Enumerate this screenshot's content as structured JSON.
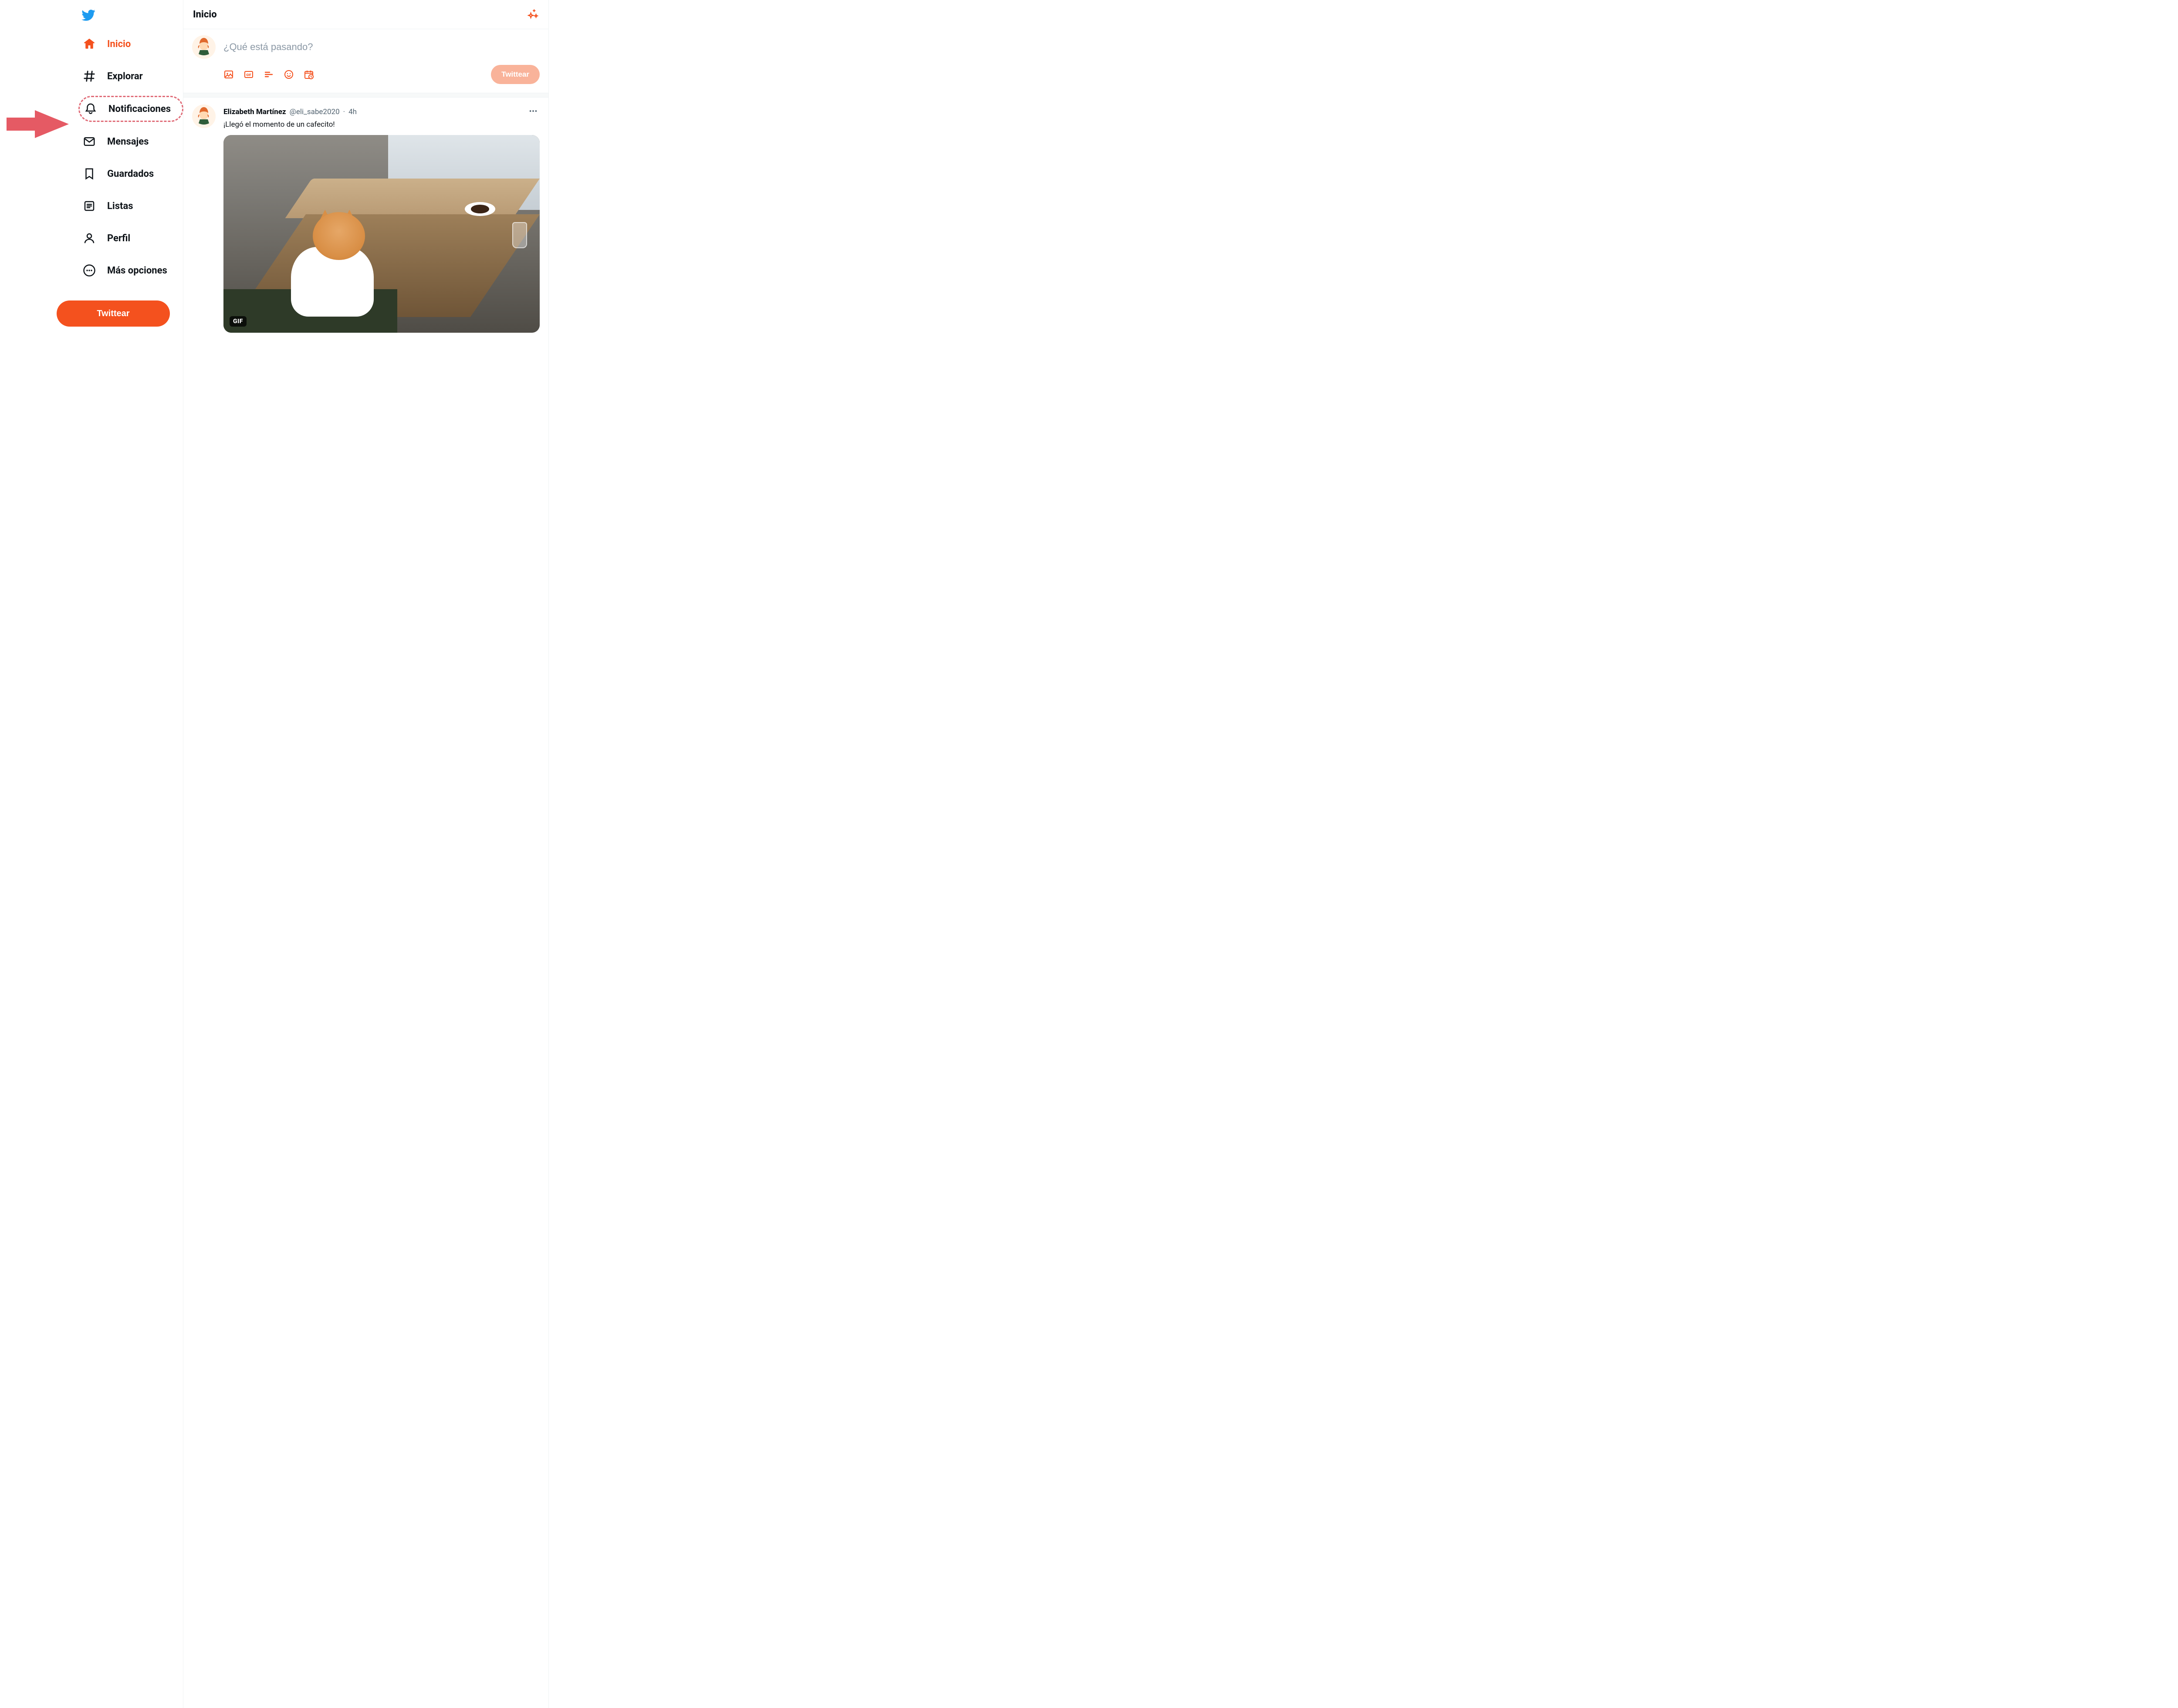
{
  "accent": "#f4511e",
  "sidebar": {
    "items": [
      {
        "id": "home",
        "label": "Inicio",
        "active": true
      },
      {
        "id": "explore",
        "label": "Explorar",
        "active": false
      },
      {
        "id": "notifications",
        "label": "Notificaciones",
        "active": false,
        "highlighted": true
      },
      {
        "id": "messages",
        "label": "Mensajes",
        "active": false
      },
      {
        "id": "bookmarks",
        "label": "Guardados",
        "active": false
      },
      {
        "id": "lists",
        "label": "Listas",
        "active": false
      },
      {
        "id": "profile",
        "label": "Perfil",
        "active": false
      },
      {
        "id": "more",
        "label": "Más opciones",
        "active": false
      }
    ],
    "tweet_button": "Twittear"
  },
  "header": {
    "title": "Inicio"
  },
  "composer": {
    "placeholder": "¿Qué está pasando?",
    "submit_label": "Twittear",
    "icons": [
      "image",
      "gif",
      "poll",
      "emoji",
      "schedule"
    ]
  },
  "feed": [
    {
      "author_name": "Elizabeth Martínez",
      "author_handle": "@eli_sabe2020",
      "separator": "·",
      "time": "4h",
      "text": "¡Llegó el momento de un cafecito!",
      "media_badge": "GIF"
    }
  ]
}
